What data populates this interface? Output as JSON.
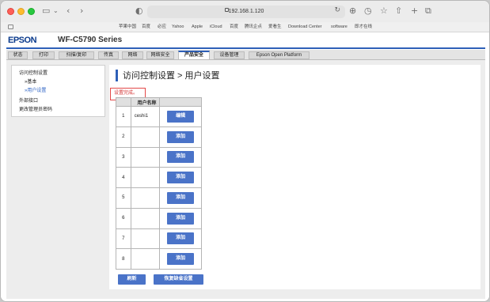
{
  "browser": {
    "url": "192.168.1.120",
    "favorites": [
      "苹果中国",
      "百度",
      "必应",
      "Yahoo",
      "Apple",
      "iCloud",
      "百度",
      "腾讯企点",
      "爱看生",
      "Download Center",
      "software",
      "即才在线"
    ]
  },
  "header": {
    "brand": "EPSON",
    "model": "WF-C5790 Series"
  },
  "tabs": [
    {
      "label": "状态"
    },
    {
      "label": "打印"
    },
    {
      "label": "扫描/复印"
    },
    {
      "label": "传真"
    },
    {
      "label": "网络"
    },
    {
      "label": "网络安全"
    },
    {
      "label": "产品安全",
      "active": true
    },
    {
      "label": "设备管理"
    },
    {
      "label": "Epson Open Platform"
    }
  ],
  "sidebar": {
    "items": [
      {
        "label": "访问控制设置"
      },
      {
        "label": "»基本"
      },
      {
        "label": "»用户设置"
      },
      {
        "label": "外部接口"
      },
      {
        "label": "更改管理员密码"
      }
    ]
  },
  "main": {
    "title": "访问控制设置 > 用户设置",
    "status": "设置完成。",
    "table": {
      "header_name": "用户名称",
      "rows": [
        {
          "no": "1",
          "name": "ceshi1",
          "action": "编辑"
        },
        {
          "no": "2",
          "name": "",
          "action": "添加"
        },
        {
          "no": "3",
          "name": "",
          "action": "添加"
        },
        {
          "no": "4",
          "name": "",
          "action": "添加"
        },
        {
          "no": "5",
          "name": "",
          "action": "添加"
        },
        {
          "no": "6",
          "name": "",
          "action": "添加"
        },
        {
          "no": "7",
          "name": "",
          "action": "添加"
        },
        {
          "no": "8",
          "name": "",
          "action": "添加"
        }
      ]
    },
    "refresh_label": "刷新",
    "restore_label": "恢复缺省设置"
  },
  "colors": {
    "accent": "#2e60b8",
    "button": "#4a73c8",
    "alert": "#e34848",
    "brand": "#0a3a8c"
  }
}
